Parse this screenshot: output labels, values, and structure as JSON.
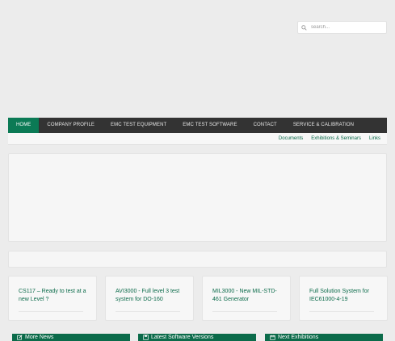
{
  "search": {
    "placeholder": "search..."
  },
  "nav": {
    "items": [
      {
        "label": "HOME"
      },
      {
        "label": "COMPANY PROFILE"
      },
      {
        "label": "EMC TEST EQUIPMENT"
      },
      {
        "label": "EMC TEST SOFTWARE"
      },
      {
        "label": "CONTACT"
      },
      {
        "label": "SERVICE & CALIBRATION"
      }
    ],
    "active": "HOME"
  },
  "subnav": {
    "links": [
      "Documents",
      "Exhibitions & Seminars",
      "Links"
    ]
  },
  "cards": [
    {
      "title": "CS117 – Ready to test at a new Level ?"
    },
    {
      "title": "AVI3000 - Full level 3 test system for DO-160"
    },
    {
      "title": "MIL3000 - New MIL-STD-461 Generator"
    },
    {
      "title": "Full Solution System for IEC61000-4-19"
    }
  ],
  "panels": [
    {
      "title": "More News",
      "icon": "edit-icon"
    },
    {
      "title": "Latest Software Versions",
      "icon": "save-icon"
    },
    {
      "title": "Next Exhibitions",
      "icon": "calendar-icon"
    }
  ],
  "colors": {
    "accent": "#0b7a55",
    "nav_bg": "#333333",
    "link": "#0b6b4a",
    "page_bg": "#ececec"
  }
}
